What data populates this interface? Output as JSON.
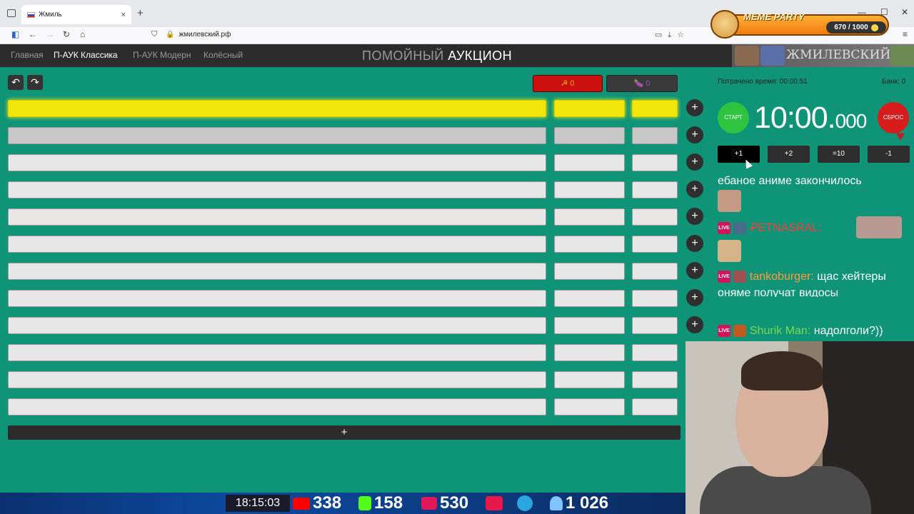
{
  "browser": {
    "tab_title": "Жмиль",
    "tab_close": "×",
    "new_tab": "+",
    "url": "жмилевский.рф",
    "window_minimize": "—",
    "window_maximize": "☐",
    "window_close": "✕"
  },
  "overlay_meme": {
    "label": "MEME PARTY",
    "progress_text": "670 / 1000",
    "progress_value": 670,
    "progress_max": 1000
  },
  "nav": {
    "items": [
      "Главная",
      "П-АУК Классика",
      "П-АУК Модерн",
      "Колёсный"
    ],
    "active_index": 1
  },
  "title": {
    "part1": "ПОМОЙНЫЙ",
    "part2": "АУКЦИОН"
  },
  "logo_text": "ЖМИЛЕВСКИЙ.РФ",
  "toolbar": {
    "undo_glyph": "↶",
    "redo_glyph": "↷",
    "counter_red": "☭ 0",
    "counter_purple": "🍆 0"
  },
  "lots": {
    "row_count": 12,
    "plus_rows": 9,
    "plus_glyph": "+",
    "add_glyph": "+"
  },
  "right": {
    "spent_label": "Потрачено время: 00:00:51",
    "bank_label": "Банк: 0",
    "start_label": "СТАРТ",
    "reset_label": "СБРОС",
    "timer_main": "10:00.",
    "timer_ms": "000",
    "time_buttons": [
      "+1",
      "+2",
      "=10",
      "-1"
    ]
  },
  "chat": {
    "msg1_text": "ебаное аниме закончилось",
    "msg2_user": "ꝒETNASRAL:",
    "msg3_user": "tankoburger:",
    "msg3_text": "щас хейтеры оняме получат видосы",
    "msg4_user": "Shurik Man:",
    "msg4_text": "надолголи?))",
    "live_badge": "LIVE"
  },
  "stream_bar": {
    "clock": "18:15:03",
    "youtube_count": "338",
    "kick_count": "158",
    "live_count": "530",
    "total_count": "1 026"
  },
  "colors": {
    "page_bg": "#0f9478",
    "leader_yellow": "#f2e60d",
    "nav_bg": "#2c2c2c",
    "start_green": "#2ec23f",
    "reset_red": "#d81c1c"
  }
}
